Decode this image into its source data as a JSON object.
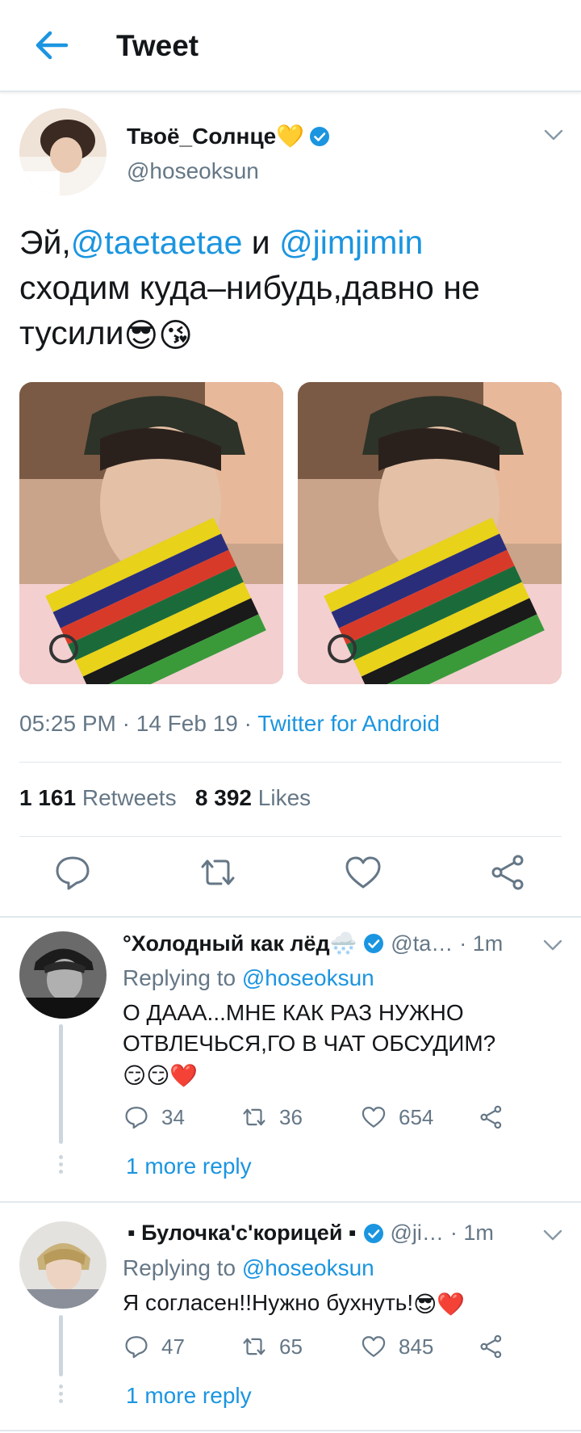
{
  "header": {
    "title": "Tweet"
  },
  "tweet": {
    "author_name": "Твоё_Солнце💛",
    "handle": "@hoseoksun",
    "text_prefix": "Эй,",
    "mention1": "@taetaetae",
    "text_and": " и ",
    "mention2": "@jimjimin",
    "text_rest": "сходим куда–нибудь,давно не тусили",
    "emojis": "😎😘",
    "time": "05:25 PM",
    "dot": " · ",
    "date": "14 Feb 19",
    "source": "Twitter for Android",
    "retweets_count": "1 161",
    "retweets_label": "Retweets",
    "likes_count": "8 392",
    "likes_label": "Likes"
  },
  "replies": [
    {
      "name": "°Холодный как лёд🌨️",
      "handle": "@ta…",
      "time": "· 1m",
      "replying_label": "Replying to",
      "replying_handle": "@hoseoksun",
      "text": "О ДААА...МНЕ КАК РАЗ НУЖНО ОТВЛЕЧЬСЯ,ГО В ЧАТ ОБСУДИМ?",
      "emojis": "😏😏❤️",
      "replies": "34",
      "retweets": "36",
      "likes": "654",
      "more": "1 more reply"
    },
    {
      "name": "▪ Булочка'с'корицей ▪",
      "handle": "@ji…",
      "time": "· 1m",
      "replying_label": "Replying to",
      "replying_handle": "@hoseoksun",
      "text": "Я согласен!!Нужно бухнуть!",
      "emojis": "😎❤️",
      "replies": "47",
      "retweets": "65",
      "likes": "845",
      "more": "1 more reply"
    }
  ],
  "colors": {
    "accent": "#1b95e0",
    "secondary": "#657786",
    "border": "#e1e8ed"
  }
}
